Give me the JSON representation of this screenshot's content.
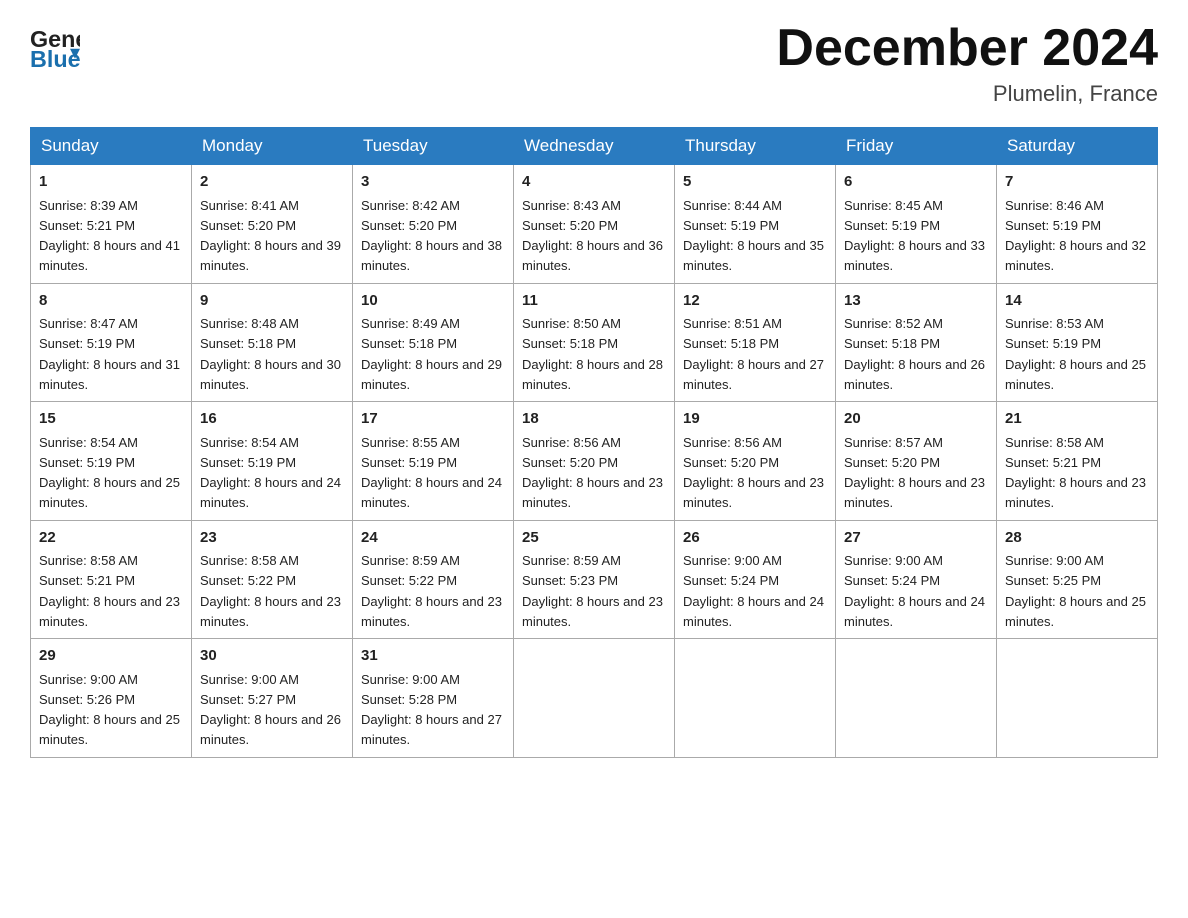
{
  "header": {
    "logo_general": "General",
    "logo_blue": "Blue",
    "month_year": "December 2024",
    "location": "Plumelin, France"
  },
  "days_of_week": [
    "Sunday",
    "Monday",
    "Tuesday",
    "Wednesday",
    "Thursday",
    "Friday",
    "Saturday"
  ],
  "weeks": [
    [
      {
        "day": "1",
        "sunrise": "8:39 AM",
        "sunset": "5:21 PM",
        "daylight": "8 hours and 41 minutes."
      },
      {
        "day": "2",
        "sunrise": "8:41 AM",
        "sunset": "5:20 PM",
        "daylight": "8 hours and 39 minutes."
      },
      {
        "day": "3",
        "sunrise": "8:42 AM",
        "sunset": "5:20 PM",
        "daylight": "8 hours and 38 minutes."
      },
      {
        "day": "4",
        "sunrise": "8:43 AM",
        "sunset": "5:20 PM",
        "daylight": "8 hours and 36 minutes."
      },
      {
        "day": "5",
        "sunrise": "8:44 AM",
        "sunset": "5:19 PM",
        "daylight": "8 hours and 35 minutes."
      },
      {
        "day": "6",
        "sunrise": "8:45 AM",
        "sunset": "5:19 PM",
        "daylight": "8 hours and 33 minutes."
      },
      {
        "day": "7",
        "sunrise": "8:46 AM",
        "sunset": "5:19 PM",
        "daylight": "8 hours and 32 minutes."
      }
    ],
    [
      {
        "day": "8",
        "sunrise": "8:47 AM",
        "sunset": "5:19 PM",
        "daylight": "8 hours and 31 minutes."
      },
      {
        "day": "9",
        "sunrise": "8:48 AM",
        "sunset": "5:18 PM",
        "daylight": "8 hours and 30 minutes."
      },
      {
        "day": "10",
        "sunrise": "8:49 AM",
        "sunset": "5:18 PM",
        "daylight": "8 hours and 29 minutes."
      },
      {
        "day": "11",
        "sunrise": "8:50 AM",
        "sunset": "5:18 PM",
        "daylight": "8 hours and 28 minutes."
      },
      {
        "day": "12",
        "sunrise": "8:51 AM",
        "sunset": "5:18 PM",
        "daylight": "8 hours and 27 minutes."
      },
      {
        "day": "13",
        "sunrise": "8:52 AM",
        "sunset": "5:18 PM",
        "daylight": "8 hours and 26 minutes."
      },
      {
        "day": "14",
        "sunrise": "8:53 AM",
        "sunset": "5:19 PM",
        "daylight": "8 hours and 25 minutes."
      }
    ],
    [
      {
        "day": "15",
        "sunrise": "8:54 AM",
        "sunset": "5:19 PM",
        "daylight": "8 hours and 25 minutes."
      },
      {
        "day": "16",
        "sunrise": "8:54 AM",
        "sunset": "5:19 PM",
        "daylight": "8 hours and 24 minutes."
      },
      {
        "day": "17",
        "sunrise": "8:55 AM",
        "sunset": "5:19 PM",
        "daylight": "8 hours and 24 minutes."
      },
      {
        "day": "18",
        "sunrise": "8:56 AM",
        "sunset": "5:20 PM",
        "daylight": "8 hours and 23 minutes."
      },
      {
        "day": "19",
        "sunrise": "8:56 AM",
        "sunset": "5:20 PM",
        "daylight": "8 hours and 23 minutes."
      },
      {
        "day": "20",
        "sunrise": "8:57 AM",
        "sunset": "5:20 PM",
        "daylight": "8 hours and 23 minutes."
      },
      {
        "day": "21",
        "sunrise": "8:58 AM",
        "sunset": "5:21 PM",
        "daylight": "8 hours and 23 minutes."
      }
    ],
    [
      {
        "day": "22",
        "sunrise": "8:58 AM",
        "sunset": "5:21 PM",
        "daylight": "8 hours and 23 minutes."
      },
      {
        "day": "23",
        "sunrise": "8:58 AM",
        "sunset": "5:22 PM",
        "daylight": "8 hours and 23 minutes."
      },
      {
        "day": "24",
        "sunrise": "8:59 AM",
        "sunset": "5:22 PM",
        "daylight": "8 hours and 23 minutes."
      },
      {
        "day": "25",
        "sunrise": "8:59 AM",
        "sunset": "5:23 PM",
        "daylight": "8 hours and 23 minutes."
      },
      {
        "day": "26",
        "sunrise": "9:00 AM",
        "sunset": "5:24 PM",
        "daylight": "8 hours and 24 minutes."
      },
      {
        "day": "27",
        "sunrise": "9:00 AM",
        "sunset": "5:24 PM",
        "daylight": "8 hours and 24 minutes."
      },
      {
        "day": "28",
        "sunrise": "9:00 AM",
        "sunset": "5:25 PM",
        "daylight": "8 hours and 25 minutes."
      }
    ],
    [
      {
        "day": "29",
        "sunrise": "9:00 AM",
        "sunset": "5:26 PM",
        "daylight": "8 hours and 25 minutes."
      },
      {
        "day": "30",
        "sunrise": "9:00 AM",
        "sunset": "5:27 PM",
        "daylight": "8 hours and 26 minutes."
      },
      {
        "day": "31",
        "sunrise": "9:00 AM",
        "sunset": "5:28 PM",
        "daylight": "8 hours and 27 minutes."
      },
      null,
      null,
      null,
      null
    ]
  ]
}
